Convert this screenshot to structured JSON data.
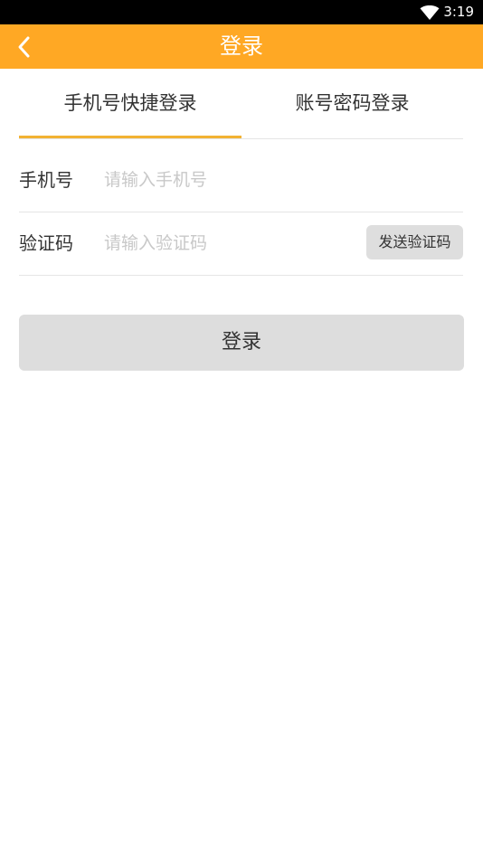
{
  "status_bar": {
    "time": "3:19",
    "wifi_icon": "wifi-icon"
  },
  "header": {
    "title": "登录",
    "back_icon": "chevron-left-icon"
  },
  "tabs": [
    {
      "label": "手机号快捷登录",
      "active": true
    },
    {
      "label": "账号密码登录",
      "active": false
    }
  ],
  "form": {
    "phone": {
      "label": "手机号",
      "placeholder": "请输入手机号",
      "value": ""
    },
    "code": {
      "label": "验证码",
      "placeholder": "请输入验证码",
      "value": "",
      "send_label": "发送验证码"
    }
  },
  "login_button": {
    "label": "登录"
  },
  "colors": {
    "accent": "#FFA824",
    "status_bar": "#000000",
    "tab_underline": "#F2B233",
    "button_disabled": "#DDDDDD",
    "placeholder": "#C8C8C8"
  }
}
